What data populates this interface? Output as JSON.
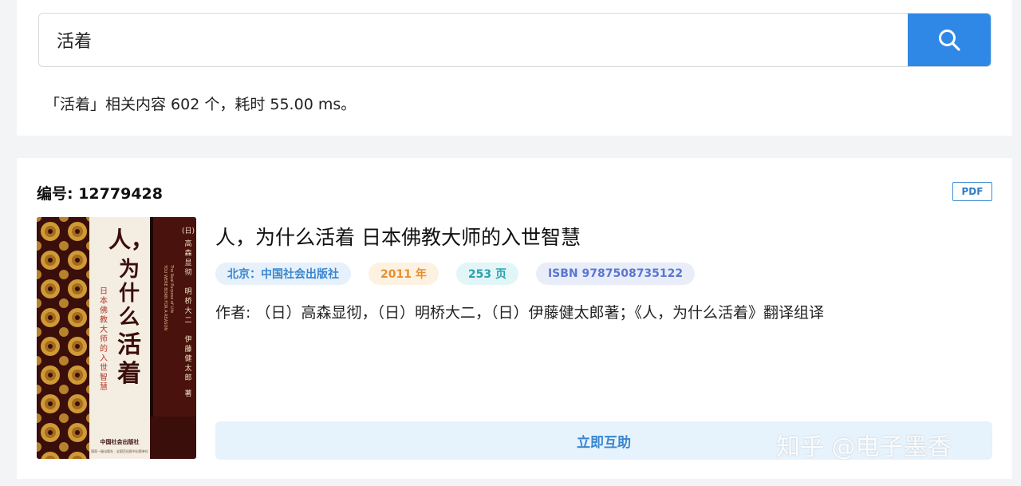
{
  "search": {
    "query": "活着",
    "button_icon": "search-icon"
  },
  "summary": "「活着」相关内容 602 个，耗时 55.00 ms。",
  "book": {
    "id_label": "编号: 12779428",
    "format": "PDF",
    "title": "人，为什么活着 日本佛教大师的入世智慧",
    "publisher": "北京：中国社会出版社",
    "year": "2011 年",
    "pages": "253 页",
    "isbn": "ISBN 9787508735122",
    "authors": "作者: （日）高森显彻，（日）明桥大二，（日）伊藤健太郎著；《人，为什么活着》翻译组译",
    "help_button": "立即互助",
    "cover": {
      "title_main": "人，为什么活着",
      "subtitle": "日本佛教大师的入世智慧",
      "authors_vertical": "（日）高森显彻 明桥大二 伊藤健太郎 著",
      "english": "YOU WERE BORN FOR A REASON · The Real Purpose of Life",
      "publisher": "中国社会出版社"
    }
  },
  "watermark": "知乎 @电子墨香",
  "colors": {
    "accent": "#2f88e5",
    "cover_dark": "#3a0e0a",
    "cover_gold": "#d4a23a"
  }
}
